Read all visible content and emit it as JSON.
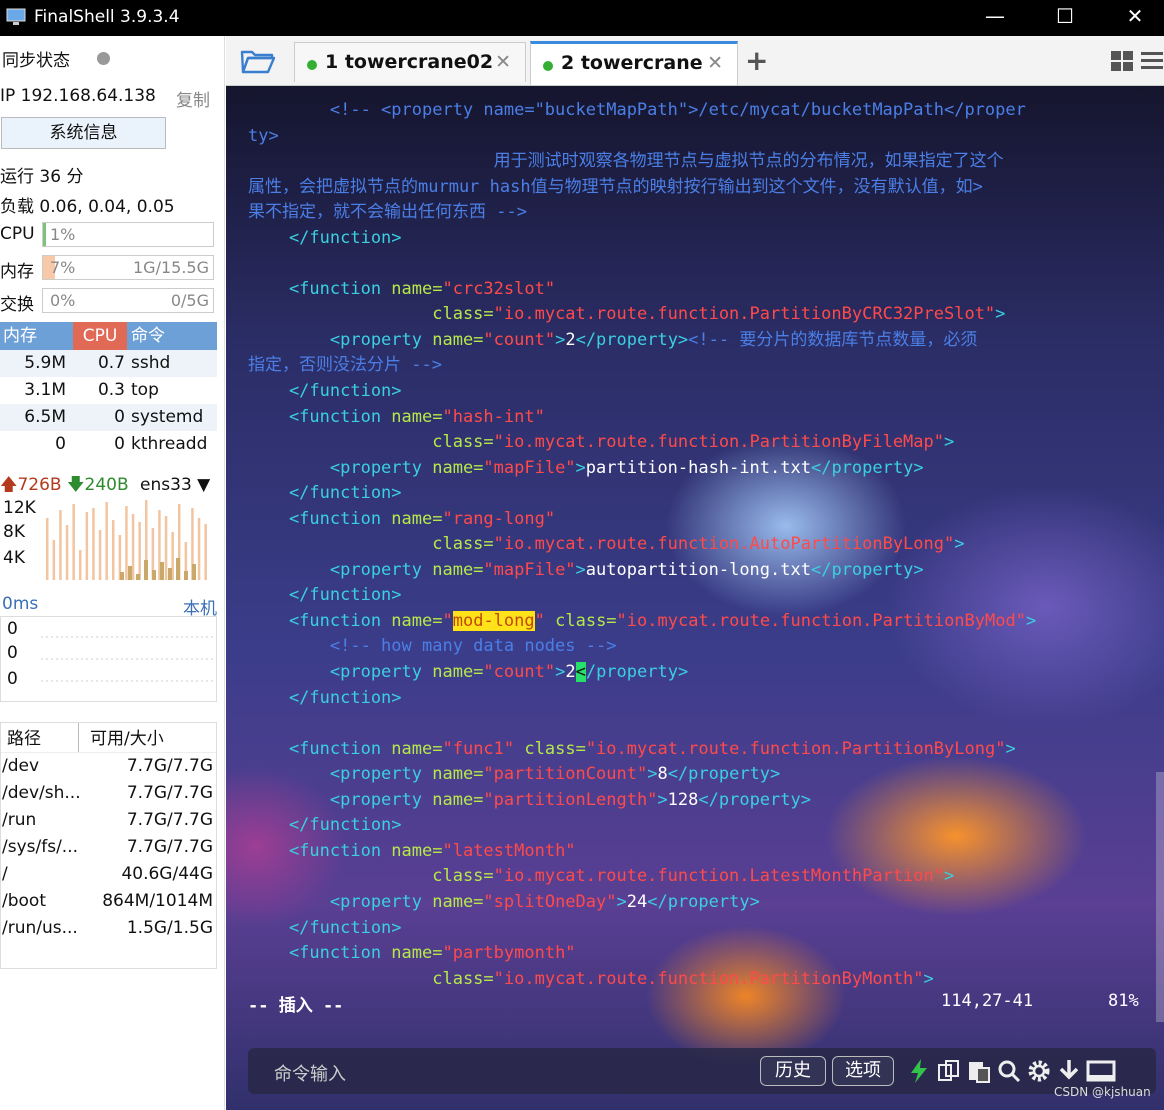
{
  "window": {
    "title": "FinalShell 3.9.3.4",
    "minimize": "—",
    "maximize": "☐",
    "close": "✕"
  },
  "sidebar": {
    "sync_label": "同步状态",
    "ip": "IP 192.168.64.138",
    "copy": "复制",
    "sysinfo_button": "系统信息",
    "uptime": "运行 36 分",
    "load": "负载 0.06, 0.04, 0.05",
    "cpu": {
      "label": "CPU",
      "pct": "1%",
      "fill": 0.01
    },
    "mem": {
      "label": "内存",
      "pct": "7%",
      "amount": "1G/15.5G",
      "fill": 0.07
    },
    "swap": {
      "label": "交换",
      "pct": "0%",
      "amount": "0/5G",
      "fill": 0.0
    },
    "proc_headers": [
      "内存",
      "CPU",
      "命令"
    ],
    "processes": [
      {
        "mem": "5.9M",
        "cpu": "0.7",
        "cmd": "sshd"
      },
      {
        "mem": "3.1M",
        "cpu": "0.3",
        "cmd": "top"
      },
      {
        "mem": "6.5M",
        "cpu": "0",
        "cmd": "systemd"
      },
      {
        "mem": "0",
        "cpu": "0",
        "cmd": "kthreadd"
      }
    ],
    "net": {
      "up": "726B",
      "down": "240B",
      "iface": "ens33"
    },
    "net_ticks": [
      "12K",
      "8K",
      "4K"
    ],
    "latency": {
      "left": "0ms",
      "right": "本机",
      "values": [
        "0",
        "0",
        "0"
      ]
    },
    "fs_headers": [
      "路径",
      "可用/大小"
    ],
    "filesystems": [
      {
        "path": "/dev",
        "size": "7.7G/7.7G"
      },
      {
        "path": "/dev/sh...",
        "size": "7.7G/7.7G"
      },
      {
        "path": "/run",
        "size": "7.7G/7.7G"
      },
      {
        "path": "/sys/fs/...",
        "size": "7.7G/7.7G"
      },
      {
        "path": "/",
        "size": "40.6G/44G"
      },
      {
        "path": "/boot",
        "size": "864M/1014M"
      },
      {
        "path": "/run/us...",
        "size": "1.5G/1.5G"
      }
    ]
  },
  "tabs": [
    {
      "label": "1 towercrane02",
      "close": "✕"
    },
    {
      "label": "2 towercrane",
      "close": "✕"
    }
  ],
  "tab_add": "+",
  "terminal": {
    "lines": [
      [
        [
          "cm",
          "        <!-- <property name=\"bucketMapPath\">/etc/mycat/bucketMapPath</proper"
        ]
      ],
      [
        [
          "cm",
          "ty>"
        ]
      ],
      [
        [
          "cm",
          "                        用于测试时观察各物理节点与虚拟节点的分布情况，如果指定了这个"
        ]
      ],
      [
        [
          "cm",
          "属性，会把虚拟节点的murmur hash值与物理节点的映射按行输出到这个文件，没有默认值，如>"
        ]
      ],
      [
        [
          "cm",
          "果不指定，就不会输出任何东西 -->"
        ]
      ],
      [
        [
          "tg",
          "    </function>"
        ]
      ],
      [
        [
          "tx",
          ""
        ]
      ],
      [
        [
          "tg",
          "    <function "
        ],
        [
          "at",
          "name="
        ],
        [
          "vl",
          "\"crc32slot\""
        ]
      ],
      [
        [
          "tx",
          "                  "
        ],
        [
          "at",
          "class="
        ],
        [
          "vl",
          "\"io.mycat.route.function.PartitionByCRC32PreSlot\""
        ],
        [
          "tg",
          ">"
        ]
      ],
      [
        [
          "tg",
          "        <property "
        ],
        [
          "at",
          "name="
        ],
        [
          "vl",
          "\"count\""
        ],
        [
          "tg",
          ">"
        ],
        [
          "tx",
          "2"
        ],
        [
          "tg",
          "</property>"
        ],
        [
          "cm",
          "<!-- 要分片的数据库节点数量，必须"
        ]
      ],
      [
        [
          "cm",
          "指定，否则没法分片 -->"
        ]
      ],
      [
        [
          "tg",
          "    </function>"
        ]
      ],
      [
        [
          "tg",
          "    <function "
        ],
        [
          "at",
          "name="
        ],
        [
          "vl",
          "\"hash-int\""
        ]
      ],
      [
        [
          "tx",
          "                  "
        ],
        [
          "at",
          "class="
        ],
        [
          "vl",
          "\"io.mycat.route.function.PartitionByFileMap\""
        ],
        [
          "tg",
          ">"
        ]
      ],
      [
        [
          "tg",
          "        <property "
        ],
        [
          "at",
          "name="
        ],
        [
          "vl",
          "\"mapFile\""
        ],
        [
          "tg",
          ">"
        ],
        [
          "tx",
          "partition-hash-int.txt"
        ],
        [
          "tg",
          "</property>"
        ]
      ],
      [
        [
          "tg",
          "    </function>"
        ]
      ],
      [
        [
          "tg",
          "    <function "
        ],
        [
          "at",
          "name="
        ],
        [
          "vl",
          "\"rang-long\""
        ]
      ],
      [
        [
          "tx",
          "                  "
        ],
        [
          "at",
          "class="
        ],
        [
          "vl",
          "\"io.mycat.route.function.AutoPartitionByLong\""
        ],
        [
          "tg",
          ">"
        ]
      ],
      [
        [
          "tg",
          "        <property "
        ],
        [
          "at",
          "name="
        ],
        [
          "vl",
          "\"mapFile\""
        ],
        [
          "tg",
          ">"
        ],
        [
          "tx",
          "autopartition-long.txt"
        ],
        [
          "tg",
          "</property>"
        ]
      ],
      [
        [
          "tg",
          "    </function>"
        ]
      ],
      [
        [
          "tg",
          "    <function "
        ],
        [
          "at",
          "name="
        ],
        [
          "vl",
          "\""
        ],
        [
          "hl",
          "mod-long"
        ],
        [
          "vl",
          "\""
        ],
        [
          "tx",
          " "
        ],
        [
          "at",
          "class="
        ],
        [
          "vl",
          "\"io.mycat.route.function.PartitionByMod\""
        ],
        [
          "tg",
          ">"
        ]
      ],
      [
        [
          "cm",
          "        <!-- how many data nodes -->"
        ]
      ],
      [
        [
          "tg",
          "        <property "
        ],
        [
          "at",
          "name="
        ],
        [
          "vl",
          "\"count\""
        ],
        [
          "tg",
          ">"
        ],
        [
          "tx",
          "2"
        ],
        [
          "cur",
          "<"
        ],
        [
          "tg",
          "/property>"
        ]
      ],
      [
        [
          "tg",
          "    </function>"
        ]
      ],
      [
        [
          "tx",
          ""
        ]
      ],
      [
        [
          "tg",
          "    <function "
        ],
        [
          "at",
          "name="
        ],
        [
          "vl",
          "\"func1\""
        ],
        [
          "tx",
          " "
        ],
        [
          "at",
          "class="
        ],
        [
          "vl",
          "\"io.mycat.route.function.PartitionByLong\""
        ],
        [
          "tg",
          ">"
        ]
      ],
      [
        [
          "tg",
          "        <property "
        ],
        [
          "at",
          "name="
        ],
        [
          "vl",
          "\"partitionCount\""
        ],
        [
          "tg",
          ">"
        ],
        [
          "tx",
          "8"
        ],
        [
          "tg",
          "</property>"
        ]
      ],
      [
        [
          "tg",
          "        <property "
        ],
        [
          "at",
          "name="
        ],
        [
          "vl",
          "\"partitionLength\""
        ],
        [
          "tg",
          ">"
        ],
        [
          "tx",
          "128"
        ],
        [
          "tg",
          "</property>"
        ]
      ],
      [
        [
          "tg",
          "    </function>"
        ]
      ],
      [
        [
          "tg",
          "    <function "
        ],
        [
          "at",
          "name="
        ],
        [
          "vl",
          "\"latestMonth\""
        ]
      ],
      [
        [
          "tx",
          "                  "
        ],
        [
          "at",
          "class="
        ],
        [
          "vl",
          "\"io.mycat.route.function.LatestMonthPartion\""
        ],
        [
          "tg",
          ">"
        ]
      ],
      [
        [
          "tg",
          "        <property "
        ],
        [
          "at",
          "name="
        ],
        [
          "vl",
          "\"splitOneDay\""
        ],
        [
          "tg",
          ">"
        ],
        [
          "tx",
          "24"
        ],
        [
          "tg",
          "</property>"
        ]
      ],
      [
        [
          "tg",
          "    </function>"
        ]
      ],
      [
        [
          "tg",
          "    <function "
        ],
        [
          "at",
          "name="
        ],
        [
          "vl",
          "\"partbymonth\""
        ]
      ],
      [
        [
          "tx",
          "                  "
        ],
        [
          "at",
          "class="
        ],
        [
          "vl",
          "\"io.mycat.route.function.PartitionByMonth\""
        ],
        [
          "tg",
          ">"
        ]
      ]
    ],
    "status_mode": "-- 插入 --",
    "status_pos": "114,27-41",
    "status_pct": "81%"
  },
  "cmdbar": {
    "placeholder": "命令输入",
    "history": "历史",
    "options": "选项"
  },
  "watermark": "CSDN @kjshuan",
  "colors": {
    "accent": "#3a8be0",
    "comment": "#4b7fe6",
    "tag": "#3ad0e0",
    "attr": "#b7e84a",
    "value": "#ff4a4a"
  }
}
